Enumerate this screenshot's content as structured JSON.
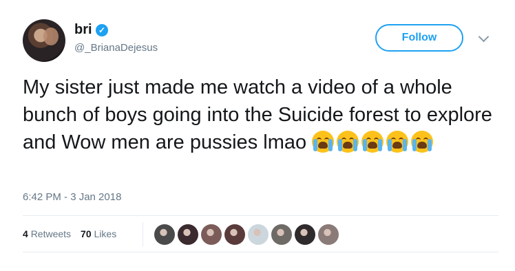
{
  "user": {
    "display_name": "bri",
    "handle": "@_BrianaDejesus",
    "verified_icon": "verified-badge-icon"
  },
  "follow_label": "Follow",
  "tweet": {
    "text": "My sister just made me watch a video of a whole bunch of boys going into the Suicide forest to explore and Wow men are pussies lmao",
    "emoji": [
      "loudly-crying-face",
      "loudly-crying-face",
      "loudly-crying-face",
      "loudly-crying-face",
      "loudly-crying-face"
    ],
    "timestamp": "6:42 PM - 3 Jan 2018"
  },
  "stats": {
    "retweets_count": "4",
    "retweets_label": "Retweets",
    "likes_count": "70",
    "likes_label": "Likes"
  },
  "likers": [
    {
      "color": "#4a4a4a"
    },
    {
      "color": "#3b2a2e"
    },
    {
      "color": "#7c5c58"
    },
    {
      "color": "#5a3b3b"
    },
    {
      "color": "#ccd6dd"
    },
    {
      "color": "#6e6a66"
    },
    {
      "color": "#2f2a2b"
    },
    {
      "color": "#8a7a78"
    }
  ]
}
